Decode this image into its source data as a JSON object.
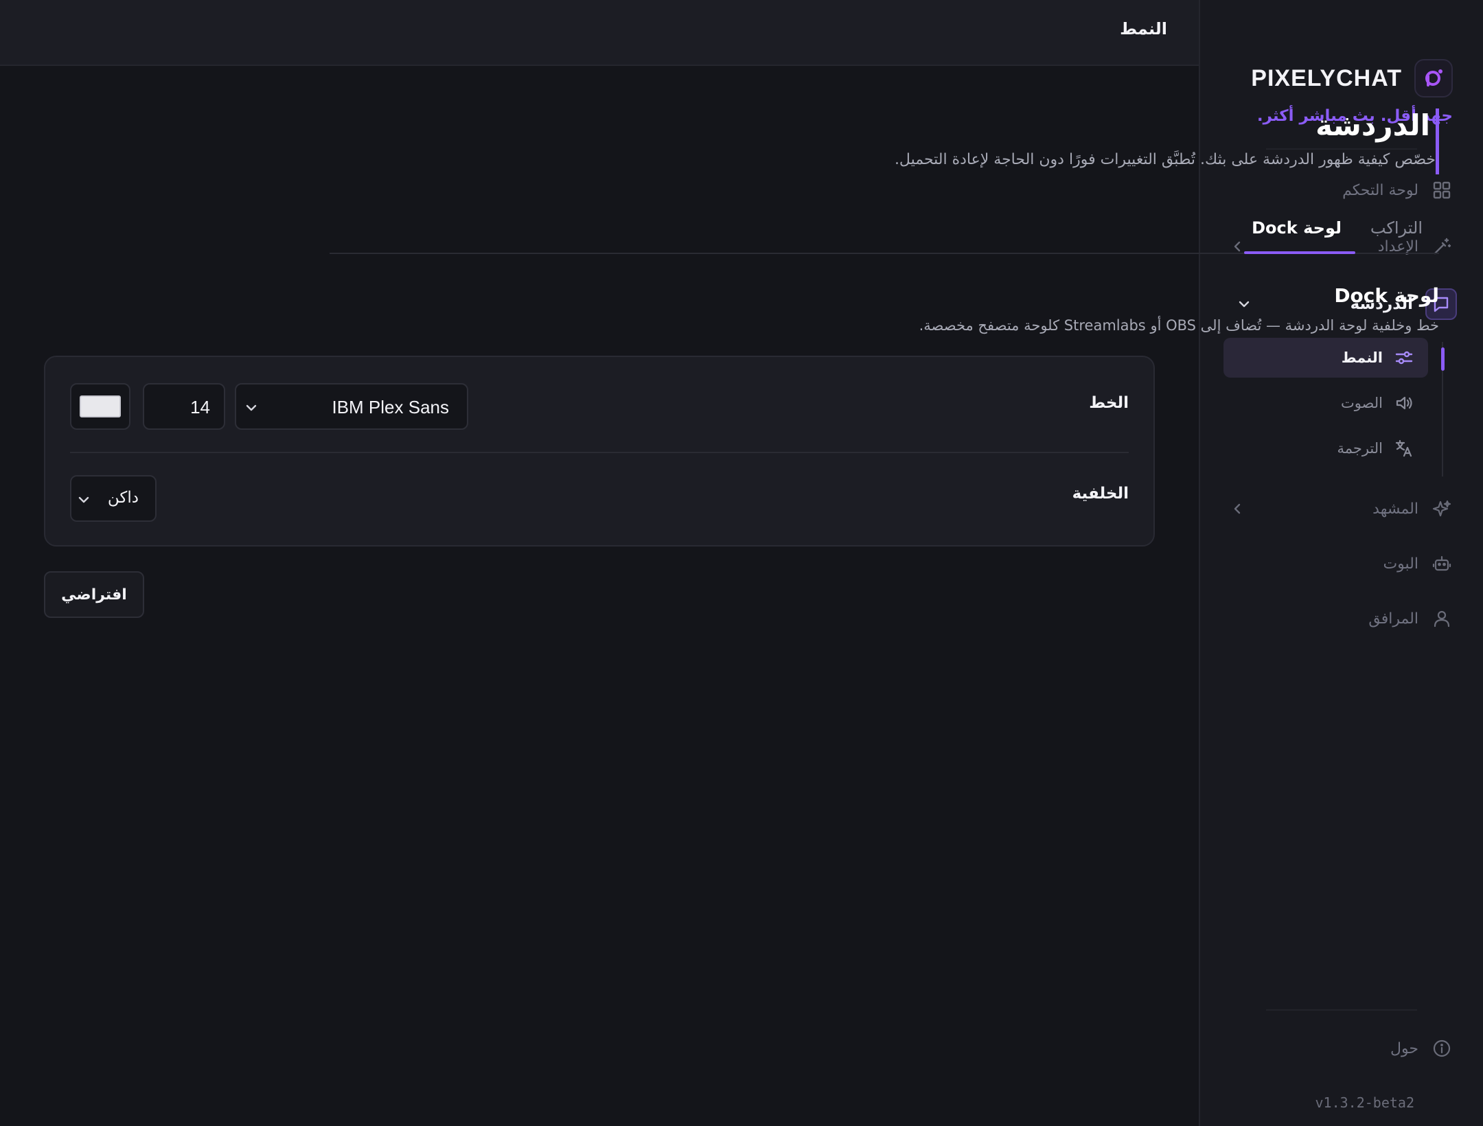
{
  "app": {
    "brand_name": "PIXELYCHAT",
    "tagline": "جهد أقل. بث مباشر أكثر.",
    "version": "v1.3.2-beta2",
    "accent_color": "#8b5cf6"
  },
  "sidebar": {
    "items": [
      {
        "label": "لوحة التحكم",
        "icon": "grid-icon"
      },
      {
        "label": "الإعداد",
        "icon": "magic-wand-icon"
      },
      {
        "label": "الدردشة",
        "icon": "chat-bubble-icon"
      },
      {
        "label": "المشهد",
        "icon": "sparkles-icon"
      },
      {
        "label": "البوت",
        "icon": "robot-icon"
      },
      {
        "label": "المرافق",
        "icon": "user-icon"
      }
    ],
    "subitems": [
      {
        "label": "النمط",
        "icon": "sliders-icon"
      },
      {
        "label": "الصوت",
        "icon": "speaker-icon"
      },
      {
        "label": "الترجمة",
        "icon": "translate-icon"
      }
    ],
    "about": {
      "label": "حول",
      "icon": "info-icon"
    }
  },
  "topbar": {
    "title": "النمط"
  },
  "page": {
    "title": "الدردشة",
    "subtitle": "خصّص كيفية ظهور الدردشة على بثك. تُطبَّق التغييرات فورًا دون الحاجة لإعادة التحميل."
  },
  "tabs": [
    {
      "label": "التراكب"
    },
    {
      "label": "لوحة Dock"
    }
  ],
  "section": {
    "title": "لوحة Dock",
    "subtitle": "خط وخلفية لوحة الدردشة — تُضاف إلى OBS أو Streamlabs كلوحة متصفح مخصصة."
  },
  "settings": {
    "font_label": "الخط",
    "font_family": "IBM Plex Sans",
    "font_size": "14",
    "font_color": "#e8e8ec",
    "background_label": "الخلفية",
    "background_value": "داكن"
  },
  "buttons": {
    "reset": "افتراضي"
  }
}
